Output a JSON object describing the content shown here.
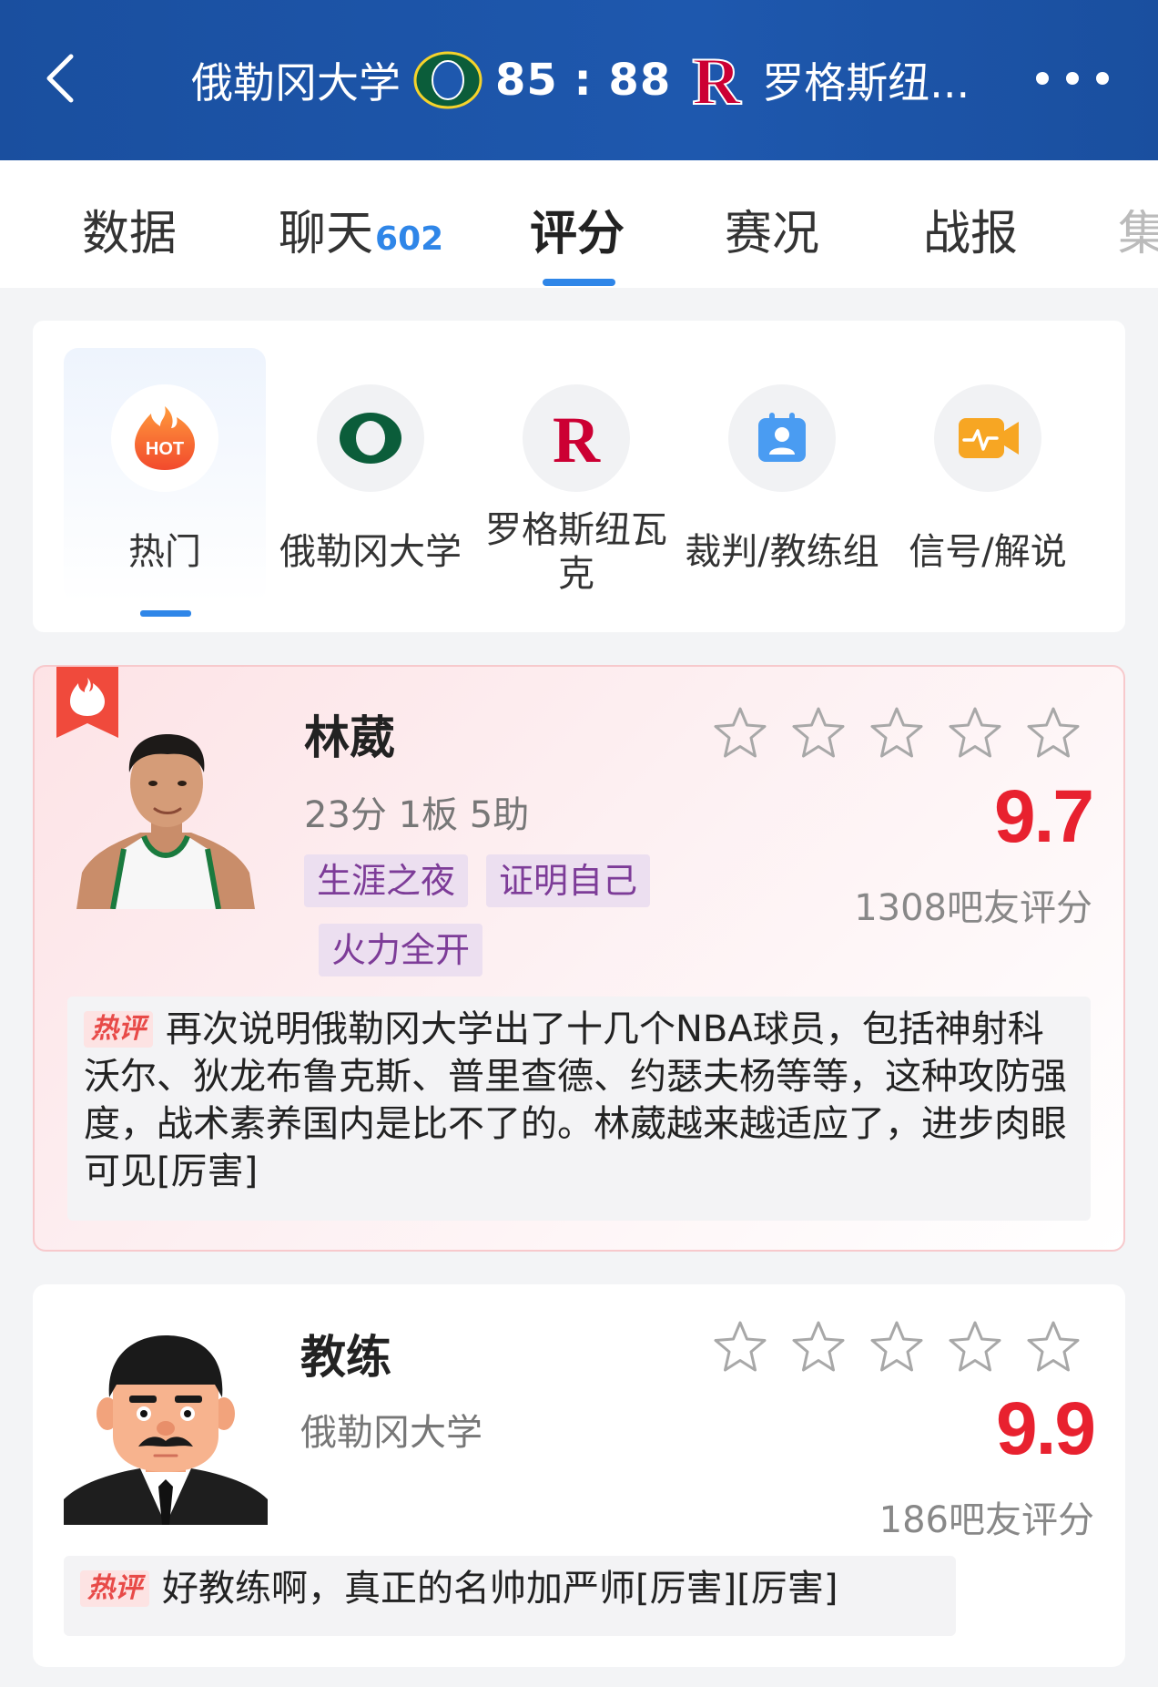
{
  "header": {
    "home_team": "俄勒冈大学",
    "score": "85 : 88",
    "away_team": "罗格斯纽..."
  },
  "tabs": [
    {
      "label": "数据"
    },
    {
      "label": "聊天",
      "badge": "602"
    },
    {
      "label": "评分"
    },
    {
      "label": "赛况"
    },
    {
      "label": "战报"
    },
    {
      "label": "集"
    }
  ],
  "categories": [
    {
      "label": "热门",
      "icon": "hot-icon"
    },
    {
      "label": "俄勒冈大学",
      "icon": "oregon-logo"
    },
    {
      "label_line1": "罗格斯纽瓦",
      "label_line2": "克",
      "icon": "rutgers-logo"
    },
    {
      "label": "裁判/教练组",
      "icon": "referee-icon"
    },
    {
      "label": "信号/解说",
      "icon": "broadcast-icon"
    }
  ],
  "player": {
    "name": "林葳",
    "stats": "23分 1板 5助",
    "tags": [
      "生涯之夜",
      "证明自己",
      "火力全开"
    ],
    "rating": "9.7",
    "rating_count": "1308吧友评分",
    "hot_label": "热评",
    "comment": "再次说明俄勒冈大学出了十几个NBA球员，包括神射科沃尔、狄龙布鲁克斯、普里查德、约瑟夫杨等等，这种攻防强度，战术素养国内是比不了的。林葳越来越适应了，进步肉眼可见[厉害]"
  },
  "coach": {
    "name": "教练",
    "team": "俄勒冈大学",
    "rating": "9.9",
    "rating_count": "186吧友评分",
    "hot_label": "热评",
    "comment": "好教练啊，真正的名帅加严师[厉害][厉害]"
  },
  "colors": {
    "header_bg": "#1e58ae",
    "accent_blue": "#2f86e8",
    "rating_red": "#e8212f",
    "tag_purple": "#7d3c98",
    "oregon_green": "#0b5d3a",
    "rutgers_red": "#cc0033"
  }
}
